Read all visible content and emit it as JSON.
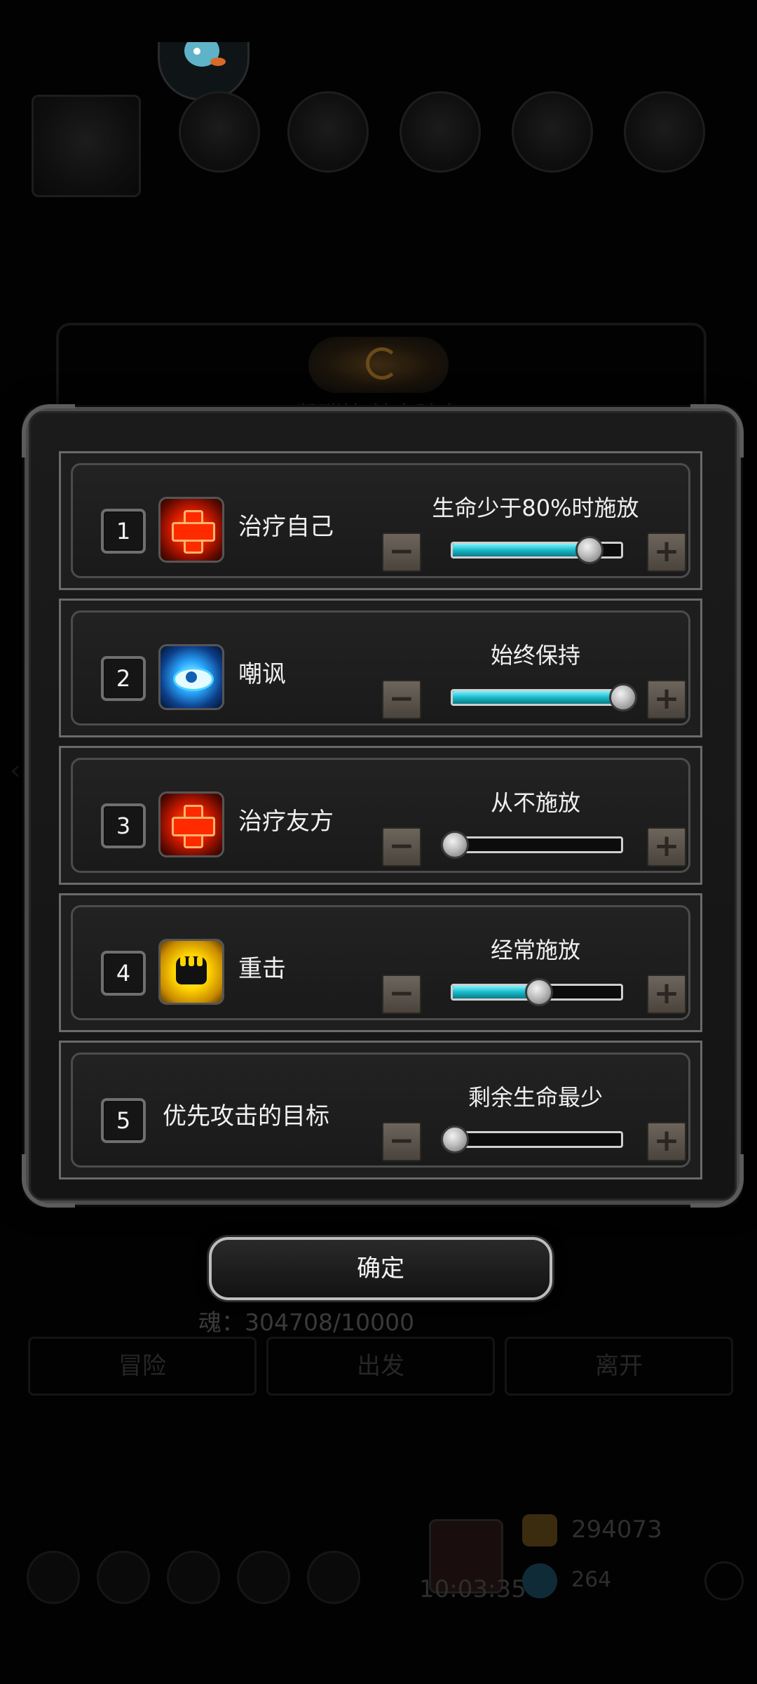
{
  "background": {
    "title_partial": "凯瑞拉 神宫骑士",
    "soul_text": "魂：304708/10000",
    "tabs": [
      "冒险",
      "出发",
      "离开"
    ],
    "timer": "10:03:35",
    "gold": "294073",
    "gems": "264"
  },
  "dialog": {
    "rows": [
      {
        "index": "1",
        "name": "治疗自己",
        "icon": "heal-cross-icon",
        "status": "生命少于80%时施放",
        "level": 0.8
      },
      {
        "index": "2",
        "name": "嘲讽",
        "icon": "eye-icon",
        "status": "始终保持",
        "level": 1.0
      },
      {
        "index": "3",
        "name": "治疗友方",
        "icon": "heal-cross-icon",
        "status": "从不施放",
        "level": 0.0
      },
      {
        "index": "4",
        "name": "重击",
        "icon": "fist-icon",
        "status": "经常施放",
        "level": 0.5
      },
      {
        "index": "5",
        "name": "优先攻击的目标",
        "icon": null,
        "status": "剩余生命最少",
        "level": 0.0
      }
    ],
    "minus_label": "−",
    "plus_label": "+",
    "confirm_label": "确定"
  },
  "colors": {
    "slider_fill": "#19b9c9",
    "heal_icon": "#ff2a00",
    "eye_icon": "#2aa9ff",
    "fist_icon": "#ffd400"
  }
}
